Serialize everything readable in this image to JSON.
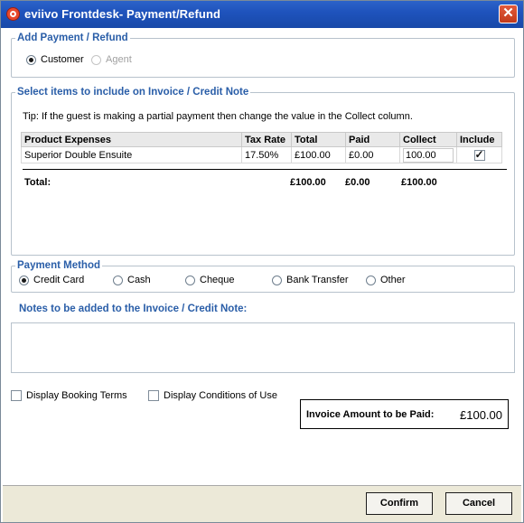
{
  "window": {
    "title": "eviivo Frontdesk- Payment/Refund",
    "icon": "eviivo-logo-icon",
    "close_glyph": "✕"
  },
  "add_payment": {
    "legend": "Add Payment / Refund",
    "options": [
      {
        "label": "Customer",
        "selected": true,
        "enabled": true
      },
      {
        "label": "Agent",
        "selected": false,
        "enabled": false
      }
    ]
  },
  "items": {
    "legend": "Select items to include on Invoice / Credit Note",
    "tip": "Tip: If the guest is making a partial payment then change the value in the Collect column.",
    "columns": [
      "Product Expenses",
      "Tax Rate",
      "Total",
      "Paid",
      "Collect",
      "Include"
    ],
    "rows": [
      {
        "product": "Superior Double Ensuite",
        "tax_rate": "17.50%",
        "total": "£100.00",
        "paid": "£0.00",
        "collect": "100.00",
        "include": true
      }
    ],
    "totals": {
      "label": "Total:",
      "total": "£100.00",
      "paid": "£0.00",
      "collect": "£100.00"
    }
  },
  "payment_method": {
    "legend": "Payment Method",
    "options": [
      {
        "label": "Credit Card",
        "selected": true
      },
      {
        "label": "Cash",
        "selected": false
      },
      {
        "label": "Cheque",
        "selected": false
      },
      {
        "label": "Bank Transfer",
        "selected": false
      },
      {
        "label": "Other",
        "selected": false
      }
    ]
  },
  "notes": {
    "label": "Notes to be added to the Invoice / Credit Note:",
    "value": ""
  },
  "options": {
    "display_booking_terms": "Display Booking Terms",
    "display_conditions": "Display Conditions of Use"
  },
  "invoice_amount": {
    "label": "Invoice Amount to be Paid:",
    "value": "£100.00"
  },
  "buttons": {
    "confirm": "Confirm",
    "cancel": "Cancel"
  },
  "colors": {
    "title_bar": "#1f53bd",
    "legend_text": "#2a5ea8",
    "footer": "#ece9d8"
  }
}
